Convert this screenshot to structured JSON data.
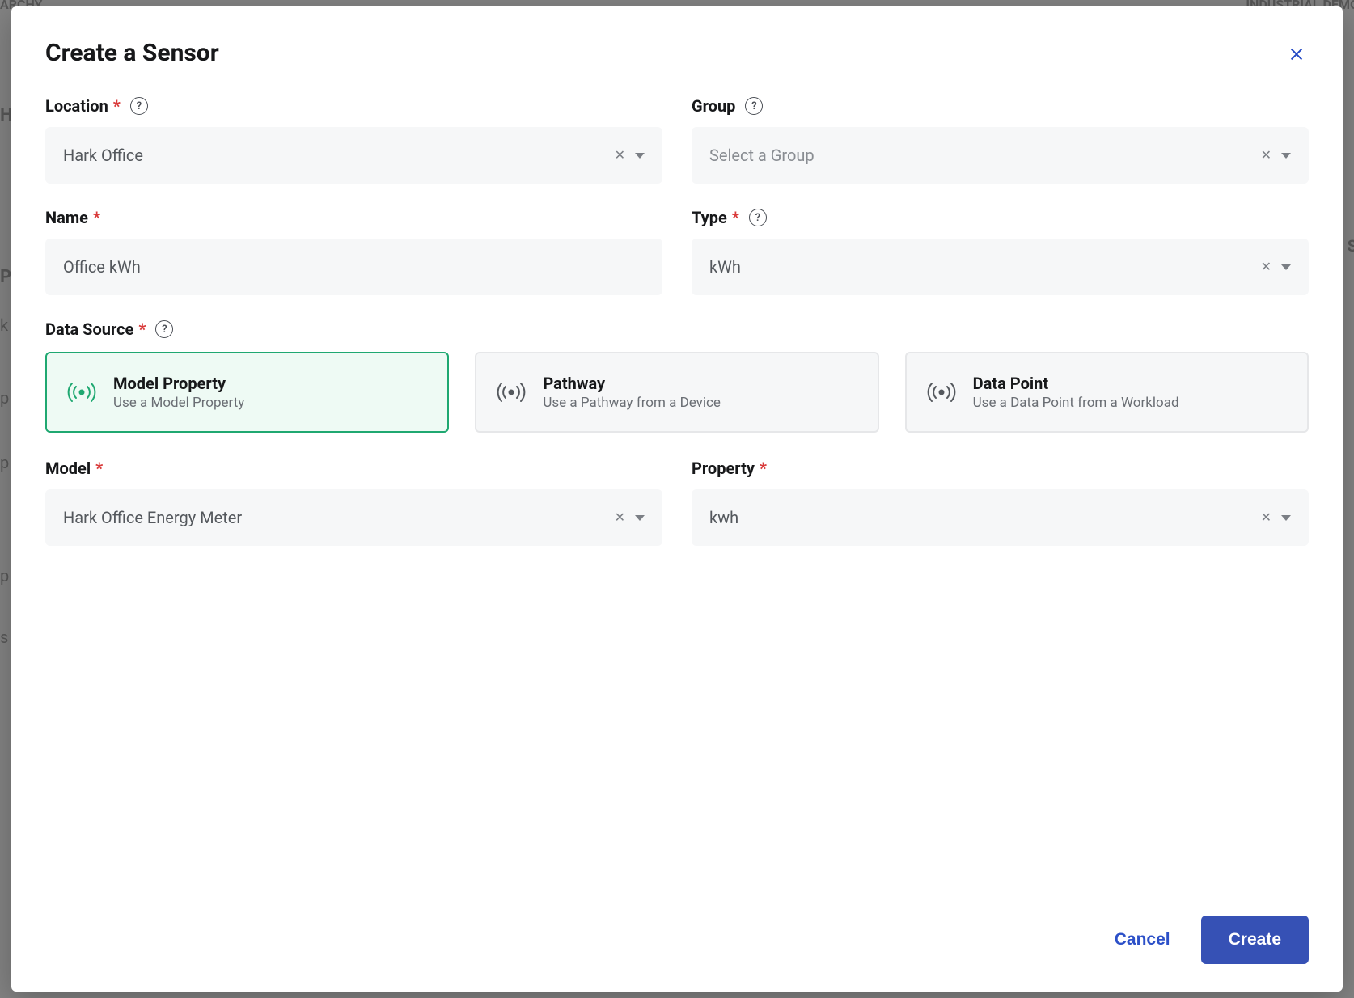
{
  "modal": {
    "title": "Create a Sensor"
  },
  "fields": {
    "location": {
      "label": "Location",
      "value": "Hark Office"
    },
    "group": {
      "label": "Group",
      "placeholder": "Select a Group"
    },
    "name": {
      "label": "Name",
      "value": "Office kWh"
    },
    "type": {
      "label": "Type",
      "value": "kWh"
    },
    "data_source": {
      "label": "Data Source"
    },
    "model": {
      "label": "Model",
      "value": "Hark Office Energy Meter"
    },
    "property": {
      "label": "Property",
      "value": "kwh"
    }
  },
  "data_source_options": [
    {
      "title": "Model Property",
      "sub": "Use a Model Property",
      "selected": true
    },
    {
      "title": "Pathway",
      "sub": "Use a Pathway from a Device",
      "selected": false
    },
    {
      "title": "Data Point",
      "sub": "Use a Data Point from a Workload",
      "selected": false
    }
  ],
  "footer": {
    "cancel": "Cancel",
    "create": "Create"
  },
  "background": {
    "top_left": "ARCHY",
    "top_right": "INDUSTRIAL DEMO",
    "left_letters": [
      "H",
      "P",
      "k",
      "p",
      "p",
      "p",
      "s"
    ],
    "right_s": "S"
  }
}
